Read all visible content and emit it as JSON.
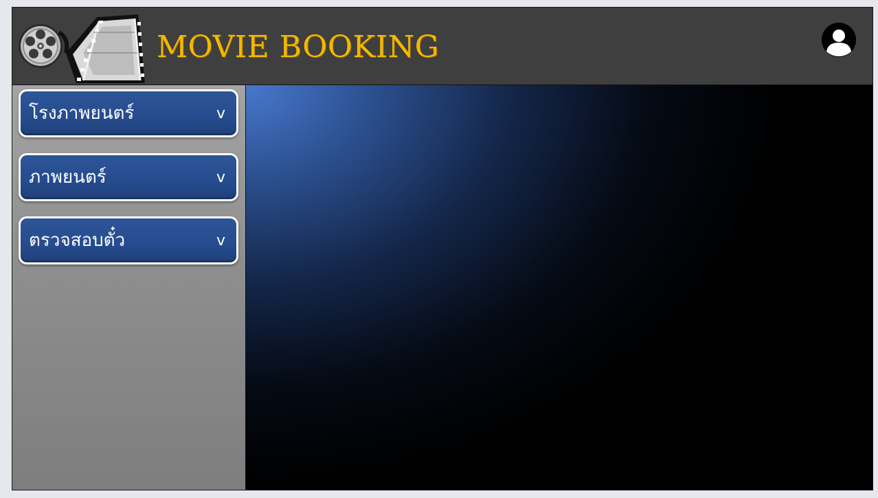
{
  "header": {
    "title": "Movie Booking",
    "logo_icon": "film-reel-icon",
    "avatar_icon": "user-avatar-icon",
    "title_color": "#f5b800",
    "background_color": "#3f3f3f"
  },
  "sidebar": {
    "items": [
      {
        "label": "โรงภาพยนตร์",
        "chevron": "v",
        "icon": "chevron-down-icon"
      },
      {
        "label": "ภาพยนตร์",
        "chevron": "v",
        "icon": "chevron-down-icon"
      },
      {
        "label": "ตรวจสอบตั๋ว",
        "chevron": "v",
        "icon": "chevron-down-icon"
      }
    ],
    "button_color": "#2a5092"
  }
}
